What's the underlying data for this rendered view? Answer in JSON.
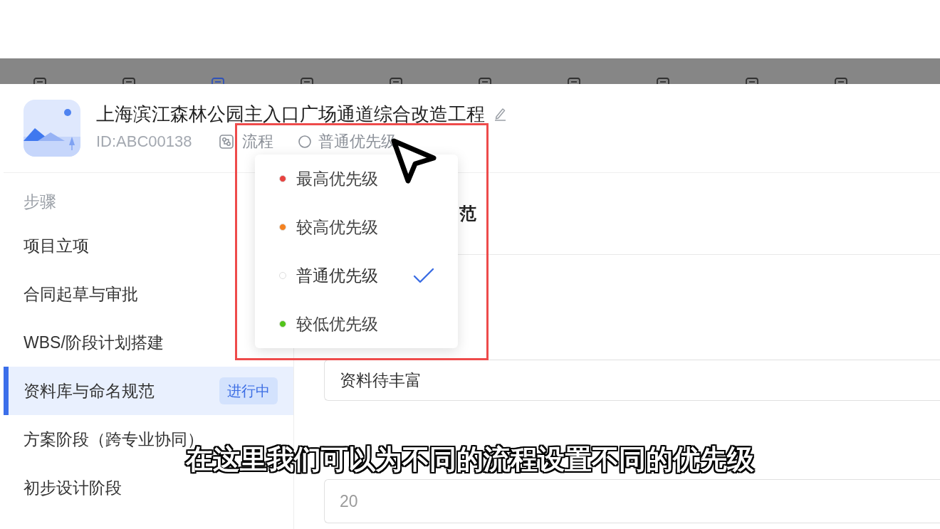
{
  "background_tabs": [
    {
      "selected": false
    },
    {
      "selected": false
    },
    {
      "selected": true
    },
    {
      "selected": false
    },
    {
      "selected": false
    },
    {
      "selected": false
    },
    {
      "selected": false
    },
    {
      "selected": false
    },
    {
      "selected": false
    },
    {
      "selected": false
    }
  ],
  "project": {
    "title": "上海滨江森林公园主入口广场通道综合改造工程",
    "id": "ID:ABC00138",
    "type": "流程",
    "priority": "普通优先级"
  },
  "sidebar": {
    "section_label": "步骤",
    "items": [
      {
        "label": "项目立项",
        "selected": false
      },
      {
        "label": "合同起草与审批",
        "selected": false
      },
      {
        "label": "WBS/阶段计划搭建",
        "selected": false
      },
      {
        "label": "资料库与命名规范",
        "selected": true,
        "badge": "进行中"
      },
      {
        "label": "方案阶段（跨专业协同）",
        "selected": false
      },
      {
        "label": "初步设计阶段",
        "selected": false
      }
    ]
  },
  "content": {
    "heading": "范",
    "fields": [
      {
        "value": "资料待丰富"
      },
      {
        "placeholder": "20"
      }
    ]
  },
  "priority_menu": {
    "items": [
      {
        "label": "最高优先级",
        "color": "#e8423f",
        "selected": false
      },
      {
        "label": "较高优先级",
        "color": "#f5821f",
        "selected": false
      },
      {
        "label": "普通优先级",
        "color": "#ffffff",
        "selected": true
      },
      {
        "label": "较低优先级",
        "color": "#52c41a",
        "selected": false
      }
    ]
  },
  "subtitle": "在这里我们可以为不同的流程设置不同的优先级"
}
